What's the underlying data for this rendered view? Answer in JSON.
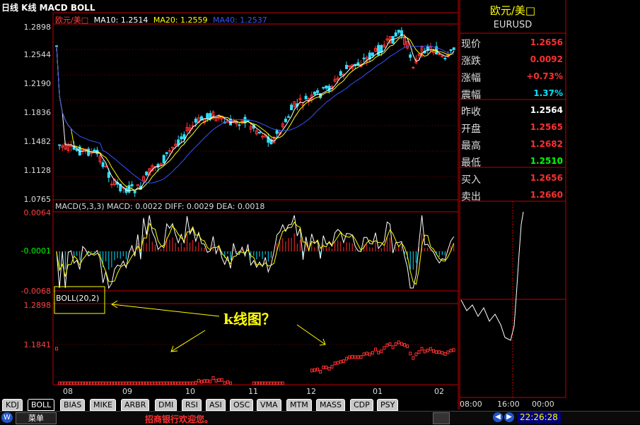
{
  "header": {
    "title": "日线 K线 MACD BOLL",
    "symbol_tag": "欧元/美□",
    "ma10_label": "MA10: 1.2514",
    "ma20_label": "MA20: 1.2559",
    "ma40_label": "MA40: 1.2537",
    "colors": {
      "ma10": "#ffffff",
      "ma20": "#ffff00",
      "ma40": "#3355ff"
    }
  },
  "price_axis": [
    "1.2898",
    "1.2544",
    "1.2190",
    "1.1836",
    "1.1482",
    "1.1128",
    "1.0765"
  ],
  "macd": {
    "header": "MACD(5,3,3) MACD: 0.0022 DIFF: 0.0029 DEA: 0.0018",
    "axis": [
      "0.0064",
      "-0.0001",
      "-0.0068"
    ]
  },
  "boll": {
    "label": "BOLL(20,2)",
    "axis": [
      "1.2898",
      "1.1841"
    ],
    "annotation": "k线图？"
  },
  "date_axis": [
    "08",
    "09",
    "10",
    "11",
    "12",
    "01",
    "02"
  ],
  "quote": {
    "name": "欧元/美□",
    "code": "EURUSD",
    "rows": [
      {
        "k": "现价",
        "v": "1.2656",
        "color": "#ff3030"
      },
      {
        "k": "涨跌",
        "v": "0.0092",
        "color": "#ff3030"
      },
      {
        "k": "涨幅",
        "v": "+0.73%",
        "color": "#ff3030"
      },
      {
        "k": "震幅",
        "v": "1.37%",
        "color": "#00e0ff"
      },
      {
        "k": "昨收",
        "v": "1.2564",
        "color": "#ffffff"
      },
      {
        "k": "开盘",
        "v": "1.2565",
        "color": "#ff3030"
      },
      {
        "k": "最高",
        "v": "1.2682",
        "color": "#ff3030"
      },
      {
        "k": "最低",
        "v": "1.2510",
        "color": "#00ff00"
      },
      {
        "k": "买入",
        "v": "1.2656",
        "color": "#ff3030"
      },
      {
        "k": "卖出",
        "v": "1.2660",
        "color": "#ff3030"
      }
    ]
  },
  "intraday": {
    "time_labels": [
      "08:00",
      "16:00",
      "00:00"
    ]
  },
  "tabs": [
    "KDJ",
    "BOLL",
    "BIAS",
    "MIKE",
    "ARBR",
    "DMI",
    "RSI",
    "ASI",
    "OSC",
    "VMA",
    "MTM",
    "MASS",
    "CDP",
    "PSY"
  ],
  "active_tab": "BOLL",
  "status": {
    "menu": "菜单",
    "ticker": "招商银行欢迎您。",
    "clock": "22:26:28"
  }
}
